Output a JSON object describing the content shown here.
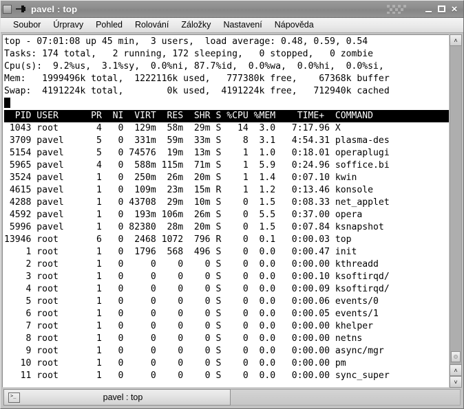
{
  "window": {
    "title": "pavel : top",
    "icons": {
      "window_menu": "window-menu-icon",
      "pin": "pin-icon",
      "minimize": "minimize-icon",
      "maximize": "maximize-icon",
      "close": "×"
    }
  },
  "menubar": {
    "items": [
      {
        "label": "Soubor"
      },
      {
        "label": "Úrpravy"
      },
      {
        "label": "Pohled"
      },
      {
        "label": "Rolování"
      },
      {
        "label": "Záložky"
      },
      {
        "label": "Nastavení"
      },
      {
        "label": "Nápověda"
      }
    ]
  },
  "terminal": {
    "summary_lines": [
      "top - 07:01:08 up 45 min,  3 users,  load average: 0.48, 0.59, 0.54",
      "Tasks: 174 total,   2 running, 172 sleeping,   0 stopped,   0 zombie",
      "Cpu(s):  9.2%us,  3.1%sy,  0.0%ni, 87.7%id,  0.0%wa,  0.0%hi,  0.0%si,",
      "Mem:   1999496k total,  1222116k used,   777380k free,    67368k buffer",
      "Swap:  4191224k total,        0k used,  4191224k free,   712940k cached"
    ],
    "header_row": "  PID USER      PR  NI  VIRT  RES  SHR S %CPU %MEM    TIME+  COMMAND",
    "rows": [
      " 1043 root       4   0  129m  58m  29m S   14  3.0   7:17.96 X",
      " 3709 pavel      5   0  331m  59m  33m S    8  3.1   4:54.31 plasma-des",
      " 5154 pavel      5   0 74576  19m  13m S    1  1.0   0:18.01 operaplugi",
      " 5965 pavel      4   0  588m 115m  71m S    1  5.9   0:24.96 soffice.bi",
      " 3524 pavel      1   0  250m  26m  20m S    1  1.4   0:07.10 kwin",
      " 4615 pavel      1   0  109m  23m  15m R    1  1.2   0:13.46 konsole",
      " 4288 pavel      1   0 43708  29m  10m S    0  1.5   0:08.33 net_applet",
      " 4592 pavel      1   0  193m 106m  26m S    0  5.5   0:37.00 opera",
      " 5996 pavel      1   0 82380  28m  20m S    0  1.5   0:07.84 ksnapshot",
      "13946 root       6   0  2468 1072  796 R    0  0.1   0:00.03 top",
      "    1 root       1   0  1796  568  496 S    0  0.0   0:00.47 init",
      "    2 root       1   0     0    0    0 S    0  0.0   0:00.00 kthreadd",
      "    3 root       1   0     0    0    0 S    0  0.0   0:00.10 ksoftirqd/",
      "    4 root       1   0     0    0    0 S    0  0.0   0:00.09 ksoftirqd/",
      "    5 root       1   0     0    0    0 S    0  0.0   0:00.06 events/0",
      "    6 root       1   0     0    0    0 S    0  0.0   0:00.05 events/1",
      "    7 root       1   0     0    0    0 S    0  0.0   0:00.00 khelper",
      "    8 root       1   0     0    0    0 S    0  0.0   0:00.00 netns",
      "    9 root       1   0     0    0    0 S    0  0.0   0:00.00 async/mgr",
      "   10 root       1   0     0    0    0 S    0  0.0   0:00.00 pm",
      "   11 root       1   0     0    0    0 S    0  0.0   0:00.00 sync_super"
    ],
    "columns": [
      "PID",
      "USER",
      "PR",
      "NI",
      "VIRT",
      "RES",
      "SHR",
      "S",
      "%CPU",
      "%MEM",
      "TIME+",
      "COMMAND"
    ]
  },
  "scrollbar": {
    "up_arrow": "˄",
    "down_arrow": "˅"
  },
  "tabbar": {
    "tab_label": "pavel : top",
    "tab_icon_text": ">_"
  },
  "colors": {
    "terminal_bg": "#ffffff",
    "terminal_fg": "#000000",
    "header_bg": "#000000",
    "header_fg": "#ffffff",
    "frame": "#c3c3c3",
    "titlebar": "#8d8d8d"
  }
}
